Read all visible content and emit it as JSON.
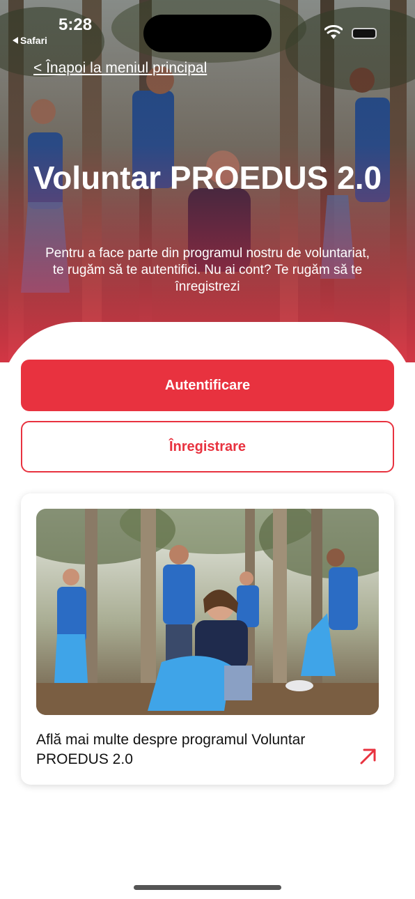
{
  "status_bar": {
    "time": "5:28",
    "back_app": "Safari",
    "icons": [
      "wifi-icon",
      "battery-icon"
    ]
  },
  "hero": {
    "back_link": "< Înapoi la meniul principal",
    "title": "Voluntar PROEDUS 2.0",
    "subtitle": "Pentru a face parte din programul nostru de voluntariat, te rugăm să te autentifici. Nu ai cont? Te rugăm să te înregistrezi"
  },
  "actions": {
    "login_label": "Autentificare",
    "register_label": "Înregistrare"
  },
  "card": {
    "text": "Află mai multe despre programul Voluntar PROEDUS 2.0",
    "icon": "arrow-up-right-icon"
  },
  "colors": {
    "accent": "#e8323f",
    "text": "#111111",
    "background": "#ffffff"
  }
}
